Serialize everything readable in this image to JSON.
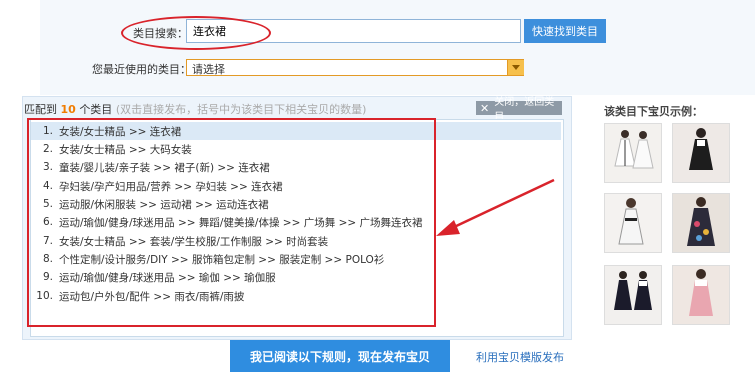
{
  "search": {
    "label": "类目搜索：",
    "value": "连衣裙",
    "button": "快速找到类目"
  },
  "recent": {
    "label": "您最近使用的类目：",
    "placeholder": "请选择"
  },
  "match": {
    "prefix": "匹配到",
    "count": "10",
    "suffix": "个类目",
    "tip": "(双击直接发布，括号中为该类目下相关宝贝的数量)",
    "close_label": "关闭，返回类目"
  },
  "results": [
    {
      "index": "1.",
      "path": "女装/女士精品 >> 连衣裙"
    },
    {
      "index": "2.",
      "path": "女装/女士精品 >> 大码女装"
    },
    {
      "index": "3.",
      "path": "童装/婴儿装/亲子装 >> 裙子(新) >> 连衣裙"
    },
    {
      "index": "4.",
      "path": "孕妇装/孕产妇用品/营养 >> 孕妇装 >> 连衣裙"
    },
    {
      "index": "5.",
      "path": "运动服/休闲服装 >> 运动裙 >> 运动连衣裙"
    },
    {
      "index": "6.",
      "path": "运动/瑜伽/健身/球迷用品 >> 舞蹈/健美操/体操 >> 广场舞 >> 广场舞连衣裙"
    },
    {
      "index": "7.",
      "path": "女装/女士精品 >> 套装/学生校服/工作制服 >> 时尚套装"
    },
    {
      "index": "8.",
      "path": "个性定制/设计服务/DIY >> 服饰箱包定制 >> 服装定制 >> POLO衫"
    },
    {
      "index": "9.",
      "path": "运动/瑜伽/健身/球迷用品 >> 瑜伽 >> 瑜伽服"
    },
    {
      "index": "10.",
      "path": "运动包/户外包/配件 >> 雨衣/雨裤/雨披"
    }
  ],
  "examples": {
    "title": "该类目下宝贝示例："
  },
  "footer": {
    "publish_button": "我已阅读以下规则，现在发布宝贝",
    "template_link": "利用宝贝模版发布"
  },
  "colors": {
    "accent_blue": "#2f8de0",
    "highlight_red": "#d9232b",
    "count_orange": "#f07c00"
  }
}
